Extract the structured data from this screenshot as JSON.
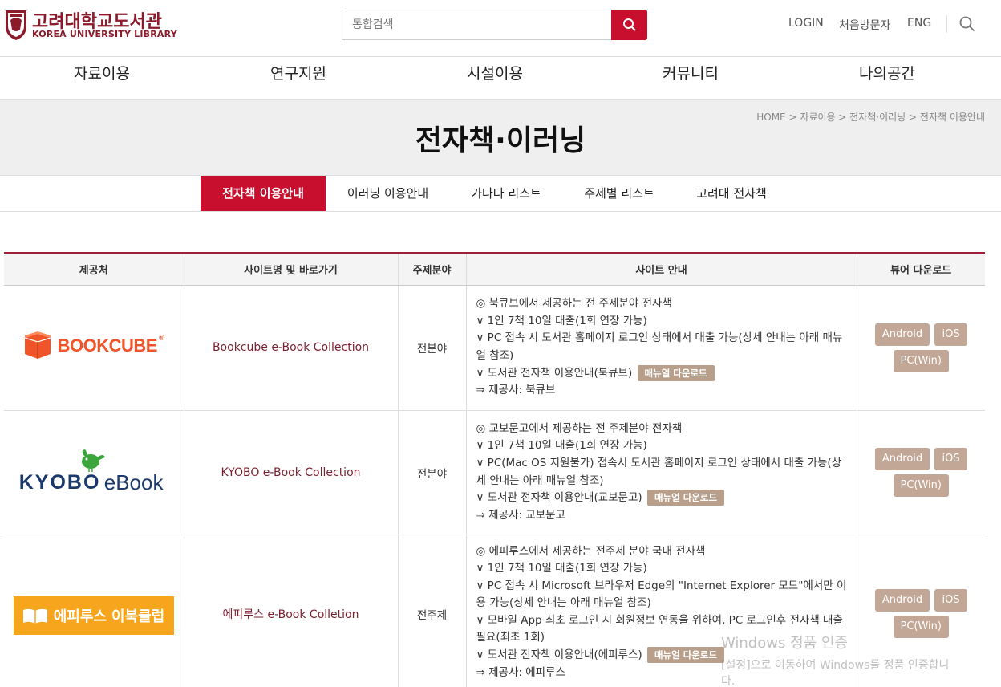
{
  "header": {
    "logo_ko": "고려대학교도서관",
    "logo_en": "KOREA UNIVERSITY LIBRARY",
    "search_placeholder": "통합검색",
    "login": "LOGIN",
    "first_visit": "처음방문자",
    "eng": "ENG"
  },
  "gnb": [
    "자료이용",
    "연구지원",
    "시설이용",
    "커뮤니티",
    "나의공간"
  ],
  "page": {
    "title": "전자책·이러닝",
    "breadcrumb": "HOME > 자료이용 > 전자책·이러닝 > 전자책 이용안내"
  },
  "subtabs": [
    "전자책 이용안내",
    "이러닝 이용안내",
    "가나다 리스트",
    "주제별 리스트",
    "고려대 전자책"
  ],
  "table": {
    "headers": [
      "제공처",
      "사이트명 및 바로가기",
      "주제분야",
      "사이트 안내",
      "뷰어 다운로드"
    ],
    "rows": [
      {
        "logo_text": "BOOKCUBE",
        "name": "Bookcube e-Book Collection",
        "field": "전분야",
        "info": [
          "◎ 북큐브에서 제공하는 전 주제분야 전자책",
          "∨ 1인 7책 10일 대출(1회 연장 가능)",
          "∨ PC 접속 시 도서관 홈페이지 로그인 상태에서 대출 가능(상세 안내는 아래 매뉴얼 참조)",
          "∨ 도서관 전자책 이용안내(북큐브)",
          "⇒ 제공사: 북큐브"
        ],
        "manual": "매뉴얼 다운로드",
        "downloads": [
          "Android",
          "iOS",
          "PC(Win)"
        ]
      },
      {
        "logo_text_1": "KYOBO",
        "logo_text_2": "eBook",
        "name": "KYOBO e-Book Collection",
        "field": "전분야",
        "info": [
          "◎ 교보문고에서 제공하는 전 주제분야 전자책",
          "∨ 1인 7책 10일 대출(1회 연장 가능)",
          "∨ PC(Mac OS 지원불가) 접속시 도서관 홈페이지 로그인 상태에서 대출 가능(상세 안내는 아래 매뉴얼 참조)",
          "∨ 도서관 전자책 이용안내(교보문고)",
          "⇒ 제공사: 교보문고"
        ],
        "manual": "매뉴얼 다운로드",
        "downloads": [
          "Android",
          "iOS",
          "PC(Win)"
        ]
      },
      {
        "logo_text_1": "에피루스",
        "logo_text_2": "이북클럽",
        "name": "에피루스 e-Book Colletion",
        "field": "전주제",
        "info": [
          "◎ 에피루스에서 제공하는 전주제 분야 국내 전자책",
          "∨ 1인 7책 10일 대출(1회 연장 가능)",
          "∨ PC 접속 시 Microsoft 브라우저 Edge의 \"Internet Explorer 모드\"에서만 이용 가능(상세 안내는 아래 매뉴얼 참조)",
          "∨ 모바일 App 최초 로그인 시 회원정보 연동을 위하여, PC 로그인후 전자책 대출 필요(최초 1회)",
          "∨ 도서관 전자책 이용안내(에피루스)",
          "⇒ 제공사: 에피루스"
        ],
        "manual": "매뉴얼 다운로드",
        "downloads": [
          "Android",
          "iOS",
          "PC(Win)"
        ]
      }
    ]
  },
  "watermark": {
    "line1": "Windows 정품 인증",
    "line2": "[설정]으로 이동하여 Windows를 정품 인증합니",
    "line3": "다."
  },
  "colors": {
    "brand": "#8b1a2b",
    "accent": "#c8102e",
    "button": "#c2a796"
  }
}
